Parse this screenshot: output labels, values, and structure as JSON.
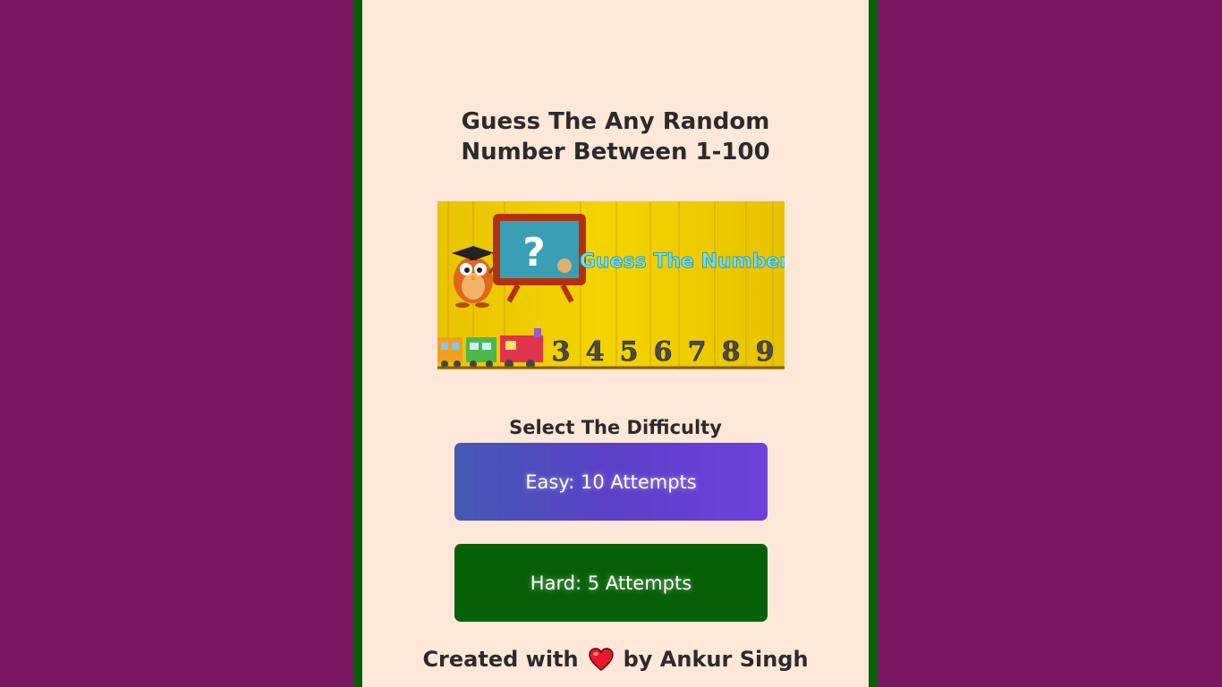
{
  "title": {
    "line1": "Guess The Any Random",
    "line2": "Number Between 1-100"
  },
  "banner": {
    "text": "Guess The Number",
    "board_symbol": "?",
    "digits": [
      "3",
      "4",
      "5",
      "6",
      "7",
      "8",
      "9"
    ]
  },
  "difficulty": {
    "label": "Select The Difficulty",
    "easy_label": "Easy: 10 Attempts",
    "hard_label": "Hard: 5 Attempts"
  },
  "footer": {
    "prefix": "Created with",
    "suffix": "by Ankur Singh",
    "icon": "heart-icon"
  },
  "colors": {
    "page_bg": "#7a1661",
    "panel_bg": "#ffe8d9",
    "panel_border": "#066106",
    "easy_button": "#5a3fc8",
    "hard_button": "#066106",
    "heart": "#e8192c"
  }
}
